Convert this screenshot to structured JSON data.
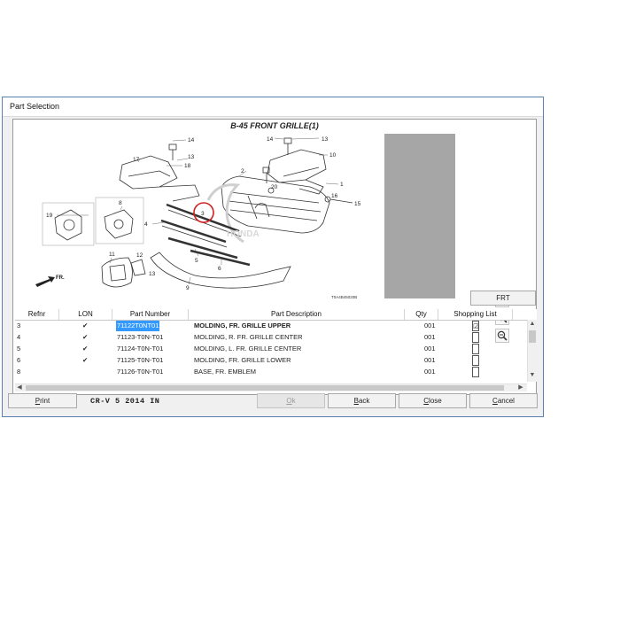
{
  "window": {
    "title": "Part Selection"
  },
  "diagram": {
    "title": "B-45 FRONT GRILLE(1)",
    "callouts": [
      "14",
      "13",
      "17",
      "18",
      "14",
      "13",
      "10",
      "2",
      "20",
      "1",
      "16",
      "15",
      "3",
      "19",
      "8",
      "4",
      "5",
      "6",
      "11",
      "12",
      "13",
      "9"
    ],
    "fr_label": "FR.",
    "drawing_code": "T0A4B45020B",
    "watermark": "HONDA"
  },
  "zoom": {
    "in_icon": "zoom-in-icon",
    "reset_icon": "zoom-reset-icon",
    "out_icon": "zoom-out-icon"
  },
  "frt_button": "FRT",
  "table": {
    "headers": [
      "Refnr",
      "LON",
      "Part Number",
      "Part Description",
      "Qty",
      "Shopping List"
    ],
    "rows": [
      {
        "refnr": "3",
        "lon": "✔",
        "part_number": "71122T0NT01",
        "description": "MOLDING, FR. GRILLE UPPER",
        "qty": "001",
        "shopping": "☑",
        "selected": true
      },
      {
        "refnr": "4",
        "lon": "✔",
        "part_number": "71123-T0N-T01",
        "description": "MOLDING, R. FR. GRILLE CENTER",
        "qty": "001",
        "shopping": "",
        "selected": false
      },
      {
        "refnr": "5",
        "lon": "✔",
        "part_number": "71124-T0N-T01",
        "description": "MOLDING, L. FR. GRILLE CENTER",
        "qty": "001",
        "shopping": "",
        "selected": false
      },
      {
        "refnr": "6",
        "lon": "✔",
        "part_number": "71125-T0N-T01",
        "description": "MOLDING, FR. GRILLE LOWER",
        "qty": "001",
        "shopping": "",
        "selected": false
      },
      {
        "refnr": "8",
        "lon": "",
        "part_number": "71126-T0N-T01",
        "description": "BASE, FR. EMBLEM",
        "qty": "001",
        "shopping": "",
        "selected": false
      }
    ]
  },
  "buttons": {
    "print_first": "P",
    "print_rest": "rint",
    "ok_first": "O",
    "ok_rest": "k",
    "back_first": "B",
    "back_rest": "ack",
    "close_first": "C",
    "close_rest": "lose",
    "cancel_first": "C",
    "cancel_rest": "ancel"
  },
  "vehicle_info": "CR-V  5  2014  IN",
  "colors": {
    "selection": "#3399ff",
    "window_border": "#5a7fb0",
    "callout_circle": "#d21e1e",
    "grey_area": "#a6a6a6"
  }
}
